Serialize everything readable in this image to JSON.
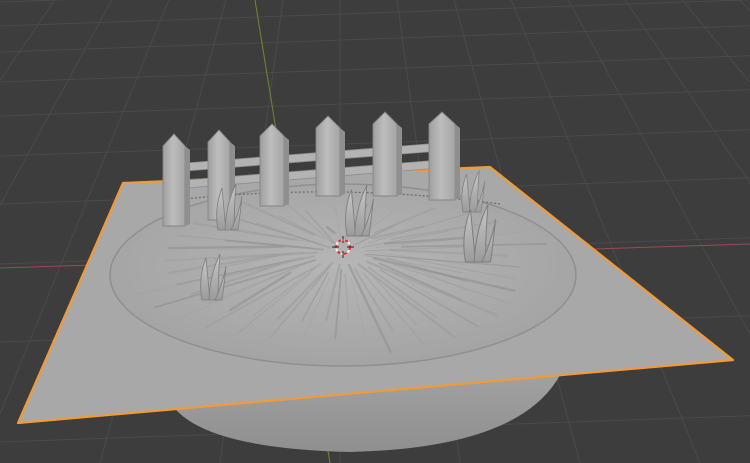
{
  "app": {
    "name": "3D viewport"
  },
  "colors": {
    "background": "#3d3d3d",
    "grid_line": "#4a4a4a",
    "x_axis": "#9c4a4f",
    "y_axis": "#6f8a2c",
    "selection_outline": "#f29a38",
    "mesh_light": "#b8b8b8",
    "mesh_mid": "#a7a7a7",
    "mesh_dark": "#8a8a8a",
    "cursor_red": "#e03030",
    "cursor_white": "#f2f2f2"
  },
  "icons": {
    "cursor": "3d-cursor-icon"
  },
  "scene": {
    "selected_object": "plane",
    "objects": [
      "plane",
      "ground-disc",
      "fence",
      "grass-tufts"
    ]
  }
}
